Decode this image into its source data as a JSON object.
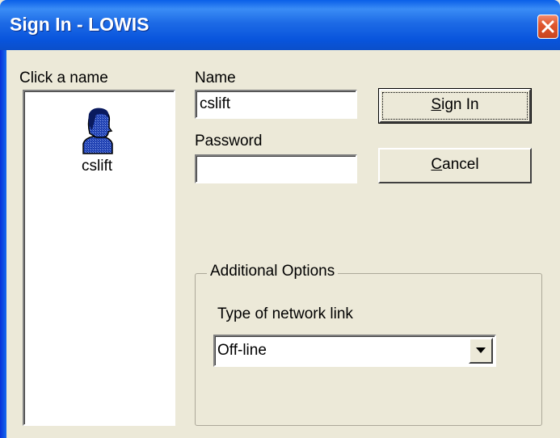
{
  "window": {
    "title": "Sign In - LOWIS",
    "close_icon": "close-icon"
  },
  "users_panel": {
    "label": "Click a name",
    "users": [
      {
        "name": "cslift",
        "icon": "user-avatar-icon"
      }
    ]
  },
  "form": {
    "name_label": "Name",
    "name_value": "cslift",
    "password_label": "Password",
    "password_value": ""
  },
  "buttons": {
    "sign_in_accel": "S",
    "sign_in_rest": "ign In",
    "cancel_accel": "C",
    "cancel_rest": "ancel"
  },
  "additional_options": {
    "legend": "Additional Options",
    "network_label": "Type of network link",
    "network_value": "Off-line",
    "dropdown_icon": "chevron-down-icon"
  },
  "colors": {
    "titlebar": "#0A5FE8",
    "window_bg": "#ECE9D8",
    "close_button": "#E0572E"
  }
}
